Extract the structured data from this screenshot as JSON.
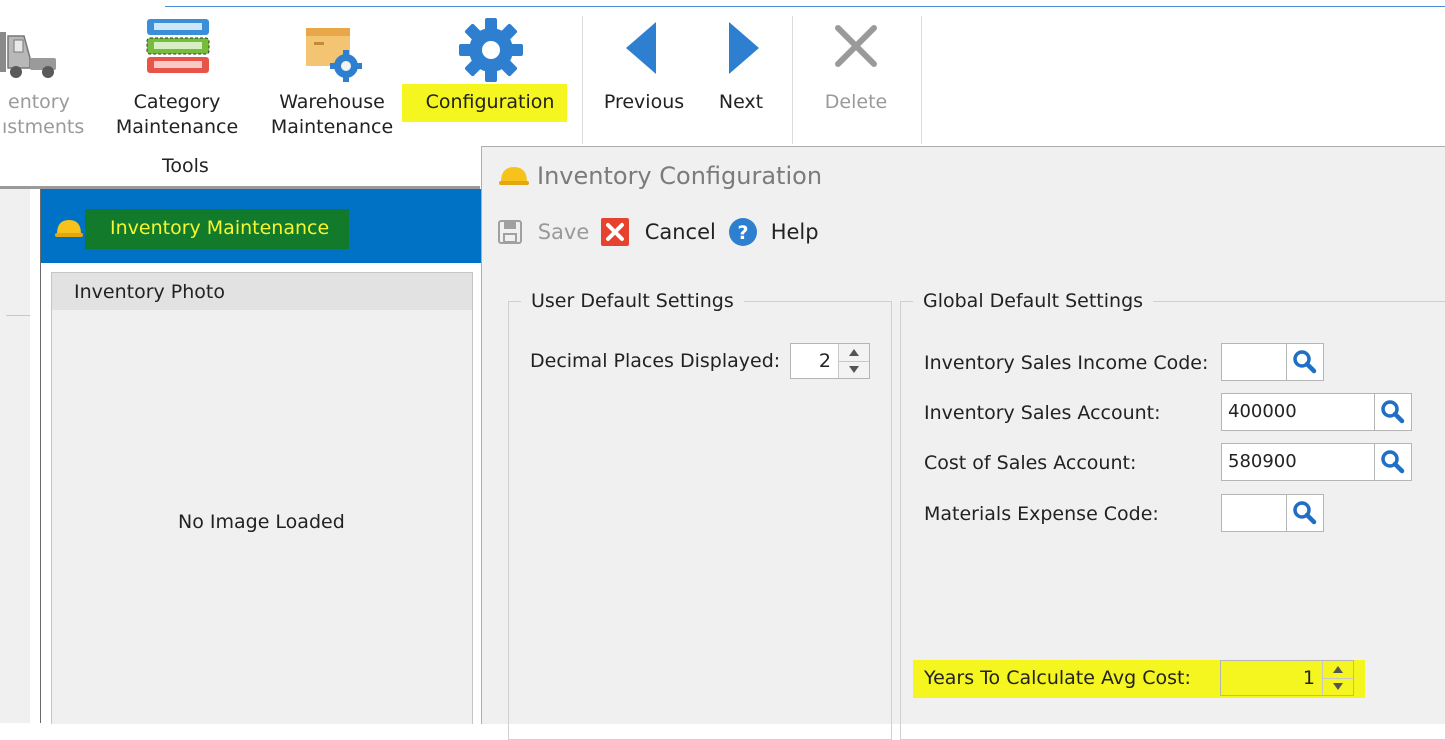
{
  "ribbon": {
    "buttons": [
      {
        "label_line1": "entory",
        "label_line2": "ıstments",
        "icon": "forklift-icon",
        "disabled": true
      },
      {
        "label_line1": "Category",
        "label_line2": "Maintenance",
        "icon": "category-icon"
      },
      {
        "label_line1": "Warehouse",
        "label_line2": "Maintenance",
        "icon": "warehouse-gear-icon"
      },
      {
        "label_line1": "Configuration",
        "label_line2": "",
        "icon": "gear-icon",
        "highlighted": true
      },
      {
        "label_line1": "Previous",
        "label_line2": "",
        "icon": "arrow-left-icon"
      },
      {
        "label_line1": "Next",
        "label_line2": "",
        "icon": "arrow-right-icon"
      },
      {
        "label_line1": "Delete",
        "label_line2": "",
        "icon": "delete-x-icon",
        "disabled": true
      }
    ],
    "group_label": "Tools"
  },
  "inventory_panel": {
    "title": "Inventory Maintenance",
    "photo_title": "Inventory Photo",
    "no_image_text": "No Image Loaded"
  },
  "config_dialog": {
    "title": "Inventory Configuration",
    "toolbar": {
      "save_label": "Save",
      "cancel_label": "Cancel",
      "help_label": "Help"
    },
    "user_defaults": {
      "legend": "User Default Settings",
      "decimal_label": "Decimal Places Displayed:",
      "decimal_value": "2"
    },
    "global_defaults": {
      "legend": "Global Default Settings",
      "sales_income_code_label": "Inventory Sales Income Code:",
      "sales_income_code_value": "",
      "sales_account_label": "Inventory Sales Account:",
      "sales_account_value": "400000",
      "cost_of_sales_label": "Cost of Sales Account:",
      "cost_of_sales_value": "580900",
      "materials_expense_label": "Materials Expense Code:",
      "materials_expense_value": "",
      "years_avg_cost_label": "Years To Calculate Avg Cost:",
      "years_avg_cost_value": "1"
    }
  },
  "colors": {
    "highlight": "#f5f51f",
    "header_blue": "#0072c6",
    "header_green": "#117a2b",
    "header_text": "#f5f532"
  }
}
